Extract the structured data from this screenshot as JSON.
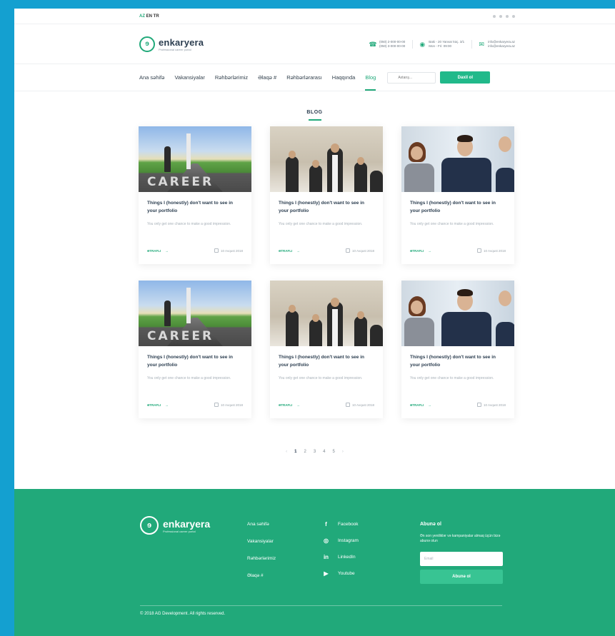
{
  "topbar": {
    "lang_prefix": "AZ",
    "lang": "EN TR"
  },
  "brand": {
    "name": "enkaryera",
    "tagline": "Professional career portal"
  },
  "contacts": [
    {
      "icon": "phone-icon",
      "line1": "(050) 2-000-00-00",
      "line2": "(050) 3-000-00-00"
    },
    {
      "icon": "location-icon",
      "line1": "Baki - 20 Yanvar küç. 3/1",
      "line2": "Mon - Fri: 09:00"
    },
    {
      "icon": "mail-icon",
      "line1": "info@enkaryera.az",
      "line2": "info@enkaryera.az"
    }
  ],
  "nav": {
    "items": [
      "Ana səhifə",
      "Vakansiyalar",
      "Rəhbərlərimiz",
      "Əlaqə #",
      "Rəhbərlərarası",
      "Haqqında",
      "Blog"
    ],
    "active_index": 6,
    "search_placeholder": "Axtarış...",
    "button_label": "Daxil ol"
  },
  "section": {
    "title": "BLOG"
  },
  "posts": [
    {
      "image": "career",
      "title": "Things I (honestly) don't want to see in your portfolio",
      "excerpt": "You only get one chance to make a good impression.",
      "more": "ƏTRAFLI",
      "date": "10 Avqust 2018"
    },
    {
      "image": "team",
      "title": "Things I (honestly) don't want to see in your portfolio",
      "excerpt": "You only get one chance to make a good impression.",
      "more": "ƏTRAFLI",
      "date": "10 Avqust 2018"
    },
    {
      "image": "office",
      "title": "Things I (honestly) don't want to see in your portfolio",
      "excerpt": "You only get one chance to make a good impression.",
      "more": "ƏTRAFLI",
      "date": "10 Avqust 2018"
    },
    {
      "image": "career",
      "title": "Things I (honestly) don't want to see in your portfolio",
      "excerpt": "You only get one chance to make a good impression.",
      "more": "ƏTRAFLI",
      "date": "10 Avqust 2018"
    },
    {
      "image": "team",
      "title": "Things I (honestly) don't want to see in your portfolio",
      "excerpt": "You only get one chance to make a good impression.",
      "more": "ƏTRAFLI",
      "date": "10 Avqust 2018"
    },
    {
      "image": "office",
      "title": "Things I (honestly) don't want to see in your portfolio",
      "excerpt": "You only get one chance to make a good impression.",
      "more": "ƏTRAFLI",
      "date": "10 Avqust 2018"
    }
  ],
  "pagination": {
    "prev": "‹",
    "pages": [
      "1",
      "2",
      "3",
      "4",
      "5"
    ],
    "current": "1",
    "next": "›"
  },
  "footer": {
    "brand_name": "enkaryera",
    "brand_tag": "Professional career portal",
    "links": [
      "Ana səhifə",
      "Vakansiyalar",
      "Rəhbərlərimiz",
      "Əlaqə #"
    ],
    "social": [
      {
        "icon": "facebook-icon",
        "glyph": "f",
        "label": "Facebook"
      },
      {
        "icon": "instagram-icon",
        "glyph": "◎",
        "label": "Instagram"
      },
      {
        "icon": "linkedin-icon",
        "glyph": "in",
        "label": "LinkedIn"
      },
      {
        "icon": "youtube-icon",
        "glyph": "▶",
        "label": "Youtube"
      }
    ],
    "subscribe_title": "Abunə ol",
    "subscribe_text": "Ən son yeniliklər və kampaniyalar almaq üçün bizə abunə olun",
    "email_placeholder": "Email",
    "subscribe_button": "Abunə ol",
    "copyright": "© 2018 AG Development. All rights reserved."
  },
  "colors": {
    "accent": "#21a97a",
    "frame": "#14a0d0"
  }
}
